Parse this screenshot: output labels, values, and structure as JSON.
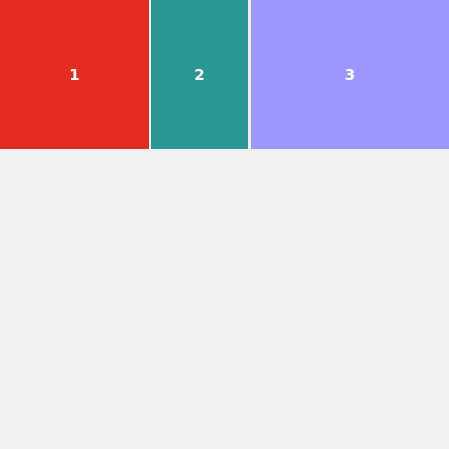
{
  "tiles": [
    {
      "label": "1",
      "color": "#e32d20"
    },
    {
      "label": "2",
      "color": "#2a9995"
    },
    {
      "label": "3",
      "color": "#9b97ff"
    }
  ],
  "background": "#f0f0f0"
}
